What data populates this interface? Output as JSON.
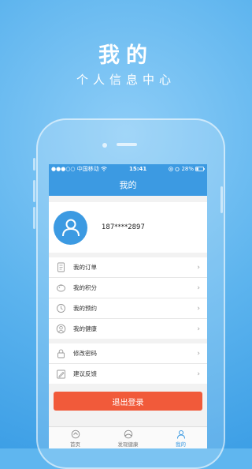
{
  "promo": {
    "title": "我的",
    "subtitle": "个人信息中心"
  },
  "status_bar": {
    "carrier": "●●●○○ 中国移动",
    "time": "15:41",
    "battery": "28%"
  },
  "navbar": {
    "title": "我的"
  },
  "profile": {
    "phone": "187****2897"
  },
  "menu_group_1": [
    {
      "label": "我的订单",
      "icon": "orders-icon"
    },
    {
      "label": "我的积分",
      "icon": "points-icon"
    },
    {
      "label": "我的预约",
      "icon": "appointment-icon"
    },
    {
      "label": "我的健康",
      "icon": "health-icon"
    }
  ],
  "menu_group_2": [
    {
      "label": "修改密码",
      "icon": "lock-icon"
    },
    {
      "label": "建议反馈",
      "icon": "feedback-icon"
    }
  ],
  "logout": {
    "label": "退出登录"
  },
  "tabs": [
    {
      "label": "首页",
      "icon": "home-icon"
    },
    {
      "label": "发现健康",
      "icon": "discover-icon"
    },
    {
      "label": "我的",
      "icon": "user-icon",
      "active": true
    }
  ],
  "colors": {
    "primary": "#3c9ae2",
    "danger": "#f15a3a",
    "background": "#5fb6ef"
  }
}
